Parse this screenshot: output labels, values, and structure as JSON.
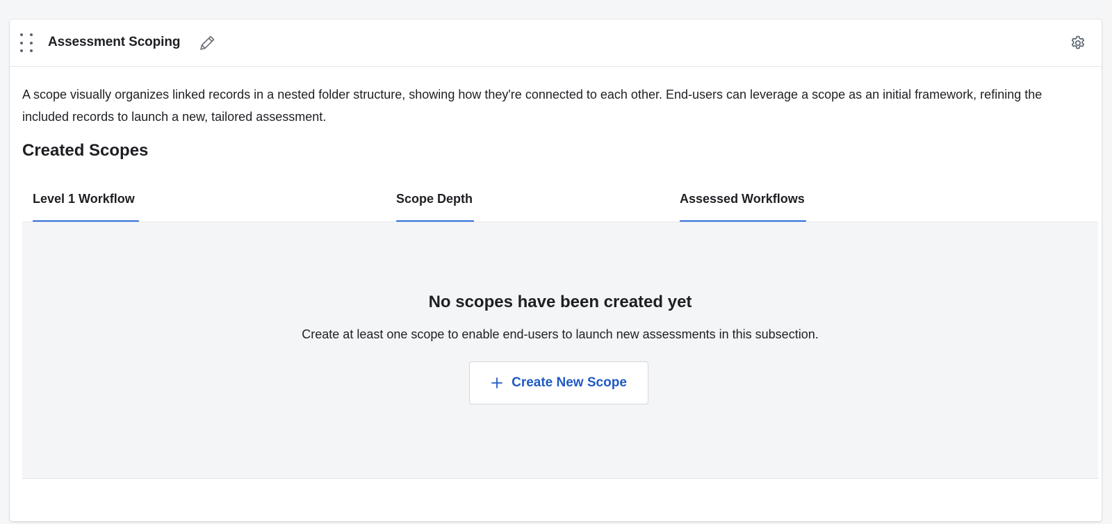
{
  "card": {
    "title": "Assessment Scoping",
    "icons": {
      "drag": "drag-handle-icon",
      "edit": "pencil-icon",
      "settings": "gear-icon"
    }
  },
  "description": "A scope visually organizes linked records in a nested folder structure, showing how they're connected to each other. End-users can leverage a scope as an initial framework, refining the included records to launch a new, tailored assessment.",
  "section_title": "Created Scopes",
  "tabs": [
    {
      "label": "Level 1 Workflow"
    },
    {
      "label": "Scope Depth"
    },
    {
      "label": "Assessed Workflows"
    }
  ],
  "empty_state": {
    "title": "No scopes have been created yet",
    "text": "Create at least one scope to enable end-users to launch new assessments in this subsection.",
    "button_label": "Create New Scope",
    "button_icon": "plus-icon"
  },
  "colors": {
    "accent": "#2f6fdf",
    "button_text": "#1f5ac4",
    "panel_bg": "#f4f5f7",
    "page_bg": "#f5f6f8"
  }
}
